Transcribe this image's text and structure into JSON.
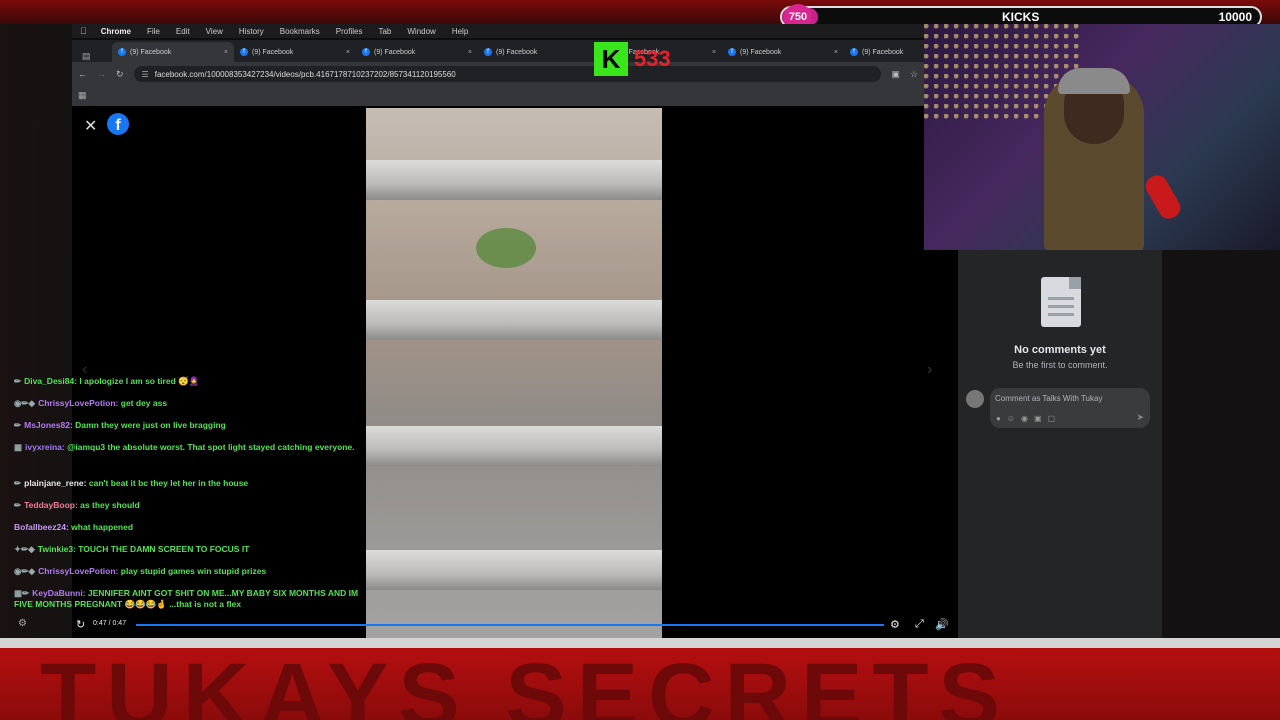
{
  "overlay": {
    "banner_text": "TUKAYS SECRETS",
    "goal": {
      "current": "750",
      "label": "KICKS",
      "target": "10000",
      "progress": 0.075,
      "fill_color": "#c9218a"
    },
    "counter": {
      "letter": "K",
      "value": "533",
      "color": "#39e61c",
      "number_color": "#e8202a"
    }
  },
  "menubar": {
    "app": "Chrome",
    "items": [
      "File",
      "Edit",
      "View",
      "History",
      "Bookmarks",
      "Profiles",
      "Tab",
      "Window",
      "Help"
    ]
  },
  "tabs": [
    {
      "label": "(9) Facebook"
    },
    {
      "label": "(9) Facebook"
    },
    {
      "label": "(9) Facebook"
    },
    {
      "label": "(9) Facebook"
    },
    {
      "label": "(9) Facebook"
    },
    {
      "label": "(9) Facebook"
    },
    {
      "label": "(9) Facebook"
    }
  ],
  "toolbar": {
    "url": "facebook.com/100008353427234/videos/pcb.4167178710237202/857341120195560"
  },
  "video": {
    "time": "0:47 / 0:47",
    "progress": 1.0,
    "accent": "#1877f2"
  },
  "comments": {
    "empty_title": "No comments yet",
    "empty_subtitle": "Be the first to comment.",
    "placeholder": "Comment as Talks With Tukay"
  },
  "chat": [
    {
      "user": "Diva_Desi84",
      "text": "I apologize I am so tired 😴🧕",
      "user_color": "#53e353"
    },
    {
      "user": "ChrissyLovePotion",
      "text": "get dey ass",
      "user_color": "#b57cf2"
    },
    {
      "user": "MsJones82",
      "text": "Damn they were just on live bragging",
      "user_color": "#b57cf2"
    },
    {
      "user": "ivyxreina",
      "text": "@iamqu3 the absolute worst. That spot light stayed catching everyone.",
      "user_color": "#a07cf2"
    },
    {
      "user": "plainjane_rene",
      "text": "can't beat it bc they let her in the house",
      "user_color": "#e6e6e6"
    },
    {
      "user": "TeddayBoop",
      "text": "as they should",
      "user_color": "#f07b9c"
    },
    {
      "user": "Bofallbeez24",
      "text": "what happened",
      "user_color": "#c59af5"
    },
    {
      "user": "Twinkie3",
      "text": "TOUCH THE DAMN SCREEN TO FOCUS IT",
      "user_color": "#53e353"
    },
    {
      "user": "ChrissyLovePotion",
      "text": "play stupid games win stupid prizes",
      "user_color": "#b57cf2"
    },
    {
      "user": "KeyDaBunni",
      "text": "JENNIFER AINT GOT SHIT ON ME...MY BABY SIX MONTHS AND IM FIVE MONTHS PREGNANT 😂😂😂🤞 ...that is not a flex",
      "user_color": "#b57cf2"
    }
  ]
}
